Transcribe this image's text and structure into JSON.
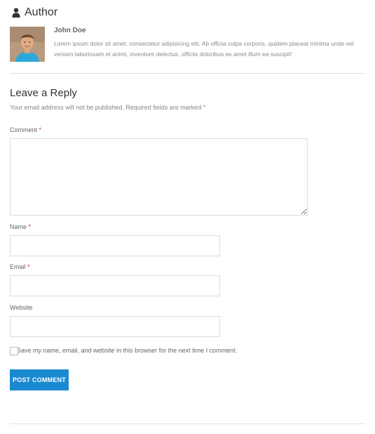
{
  "author_box": {
    "heading": "Author",
    "name": "John Doe",
    "bio": "Lorem ipsum dolor sit amet, consectetur adipisicing elit. Ab officia culpa corporis, quidem placeat minima unde vel veniam laboriosam et animi, inventore delectus, officiis doloribus ex amet illum ea suscipit!"
  },
  "reply_form": {
    "title": "Leave a Reply",
    "notes": "Your email address will not be published. Required fields are marked",
    "required_marker": "*",
    "comment_label": "Comment",
    "name_label": "Name",
    "email_label": "Email",
    "website_label": "Website",
    "comment_value": "",
    "name_value": "",
    "email_value": "",
    "website_value": "",
    "consent_label": "Save my name, email, and website in this browser for the next time I comment.",
    "consent_checked": false,
    "submit_label": "POST COMMENT"
  },
  "colors": {
    "button": "#1a8ad0",
    "required": "#c0392b",
    "divider": "#e0e0e0"
  },
  "icons": {
    "author": "user-icon"
  }
}
